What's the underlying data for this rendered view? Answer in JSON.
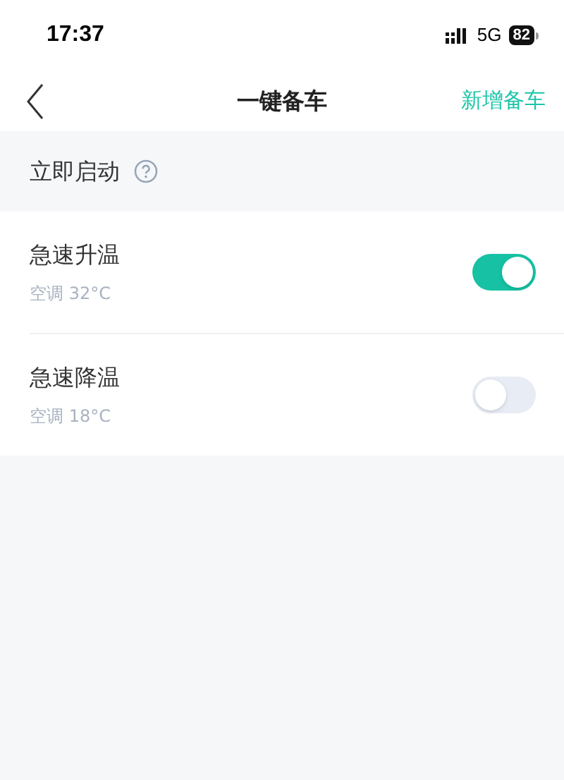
{
  "status_bar": {
    "time": "17:37",
    "network": "5G",
    "battery": "82"
  },
  "nav_bar": {
    "title": "一键备车",
    "action": "新增备车"
  },
  "section": {
    "title": "立即启动"
  },
  "items": [
    {
      "title": "急速升温",
      "subtitle": "空调 32°C",
      "on": true
    },
    {
      "title": "急速降温",
      "subtitle": "空调 18°C",
      "on": false
    }
  ]
}
